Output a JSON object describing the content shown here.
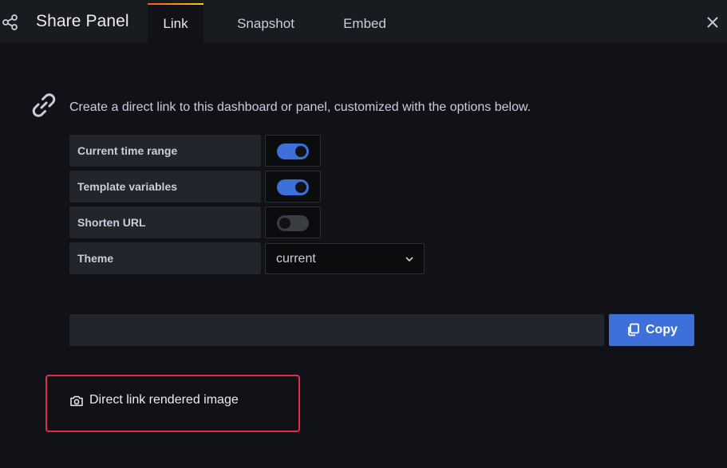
{
  "header": {
    "title": "Share Panel",
    "title_icon": "share-icon",
    "tabs": [
      {
        "label": "Link",
        "active": true
      },
      {
        "label": "Snapshot",
        "active": false
      },
      {
        "label": "Embed",
        "active": false
      }
    ],
    "close_icon": "close-icon"
  },
  "body": {
    "icon": "link-icon",
    "description": "Create a direct link to this dashboard or panel, customized with the options below.",
    "options": [
      {
        "label": "Current time range",
        "type": "switch",
        "enabled": true
      },
      {
        "label": "Template variables",
        "type": "switch",
        "enabled": true
      },
      {
        "label": "Shorten URL",
        "type": "switch",
        "enabled": false
      },
      {
        "label": "Theme",
        "type": "select",
        "value": "current"
      }
    ],
    "copy_button": {
      "label": "Copy",
      "icon": "copy-icon"
    },
    "render_link": {
      "label": "Direct link rendered image",
      "icon": "camera-icon"
    }
  },
  "colors": {
    "background": "#111217",
    "header_background": "#181b1f",
    "primary_button": "#3d71d9",
    "highlight_border": "#e02f44"
  }
}
